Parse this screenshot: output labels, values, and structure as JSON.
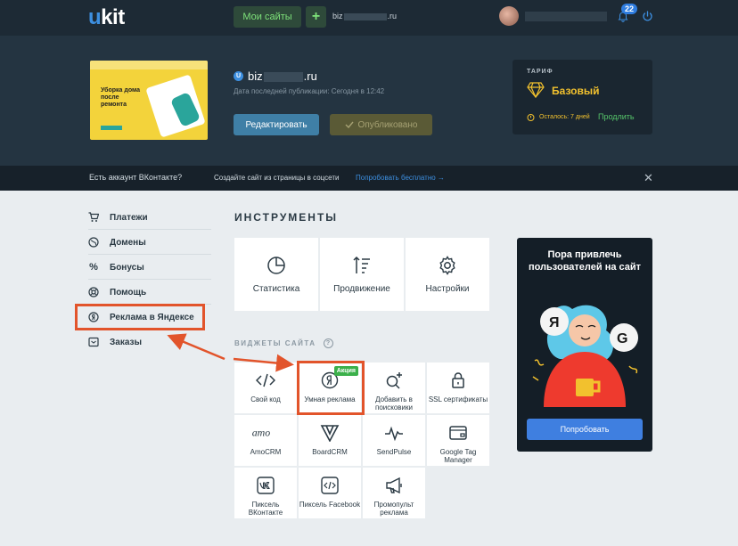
{
  "topbar": {
    "logo_u": "u",
    "logo_rest": "kit",
    "my_sites": "Мои сайты",
    "add": "+",
    "domain_prefix": "biz",
    "domain_suffix": ".ru",
    "notifications": "22"
  },
  "site": {
    "icon": "U",
    "name_prefix": "biz",
    "name_suffix": ".ru",
    "last_published": "Дата последней публикации: Сегодня в 12:42",
    "edit": "Редактировать",
    "published": "Опубликовано",
    "thumb_title": "Уборка дома после ремонта"
  },
  "tariff": {
    "label": "ТАРИФ",
    "plan": "Базовый",
    "remaining": "Осталось: 7 дней",
    "renew": "Продлить"
  },
  "vk": {
    "question": "Есть аккаунт ВКонтакте?",
    "subtitle": "Создайте сайт из страницы в соцсети",
    "try": "Попробовать бесплатно →",
    "close": "✕"
  },
  "sidebar": {
    "items": [
      {
        "label": "Платежи",
        "icon": "cart-icon"
      },
      {
        "label": "Домены",
        "icon": "globe-icon"
      },
      {
        "label": "Бонусы",
        "icon": "percent-icon"
      },
      {
        "label": "Помощь",
        "icon": "lifebuoy-icon"
      },
      {
        "label": "Реклама в Яндексе",
        "icon": "yandex-icon"
      },
      {
        "label": "Заказы",
        "icon": "inbox-icon"
      }
    ]
  },
  "tools": {
    "title": "ИНСТРУМЕНТЫ",
    "items": [
      {
        "label": "Статистика",
        "icon": "pie-chart-icon"
      },
      {
        "label": "Продвижение",
        "icon": "sort-icon"
      },
      {
        "label": "Настройки",
        "icon": "gear-icon"
      }
    ]
  },
  "widgets": {
    "title": "ВИДЖЕТЫ САЙТА",
    "help": "?",
    "promo_badge": "Акция",
    "items": [
      {
        "label": "Свой код",
        "icon": "code-icon"
      },
      {
        "label": "Умная реклама",
        "icon": "yandex-icon"
      },
      {
        "label": "Добавить в поисковики",
        "icon": "search-plus-icon"
      },
      {
        "label": "SSL сертификаты",
        "icon": "lock-icon"
      },
      {
        "label": "AmoCRM",
        "icon": "amo-logo-icon"
      },
      {
        "label": "BoardCRM",
        "icon": "board-logo-icon"
      },
      {
        "label": "SendPulse",
        "icon": "pulse-icon"
      },
      {
        "label": "Google Tag Manager",
        "icon": "wallet-icon"
      },
      {
        "label": "Пиксель ВКонтакте",
        "icon": "vk-icon"
      },
      {
        "label": "Пиксель Facebook",
        "icon": "code-square-icon"
      },
      {
        "label": "Промопульт реклама",
        "icon": "megaphone-icon"
      }
    ]
  },
  "promo": {
    "title": "Пора привлечь пользователей на сайт",
    "button": "Попробовать",
    "bubble_y": "Я",
    "bubble_g": "G"
  }
}
